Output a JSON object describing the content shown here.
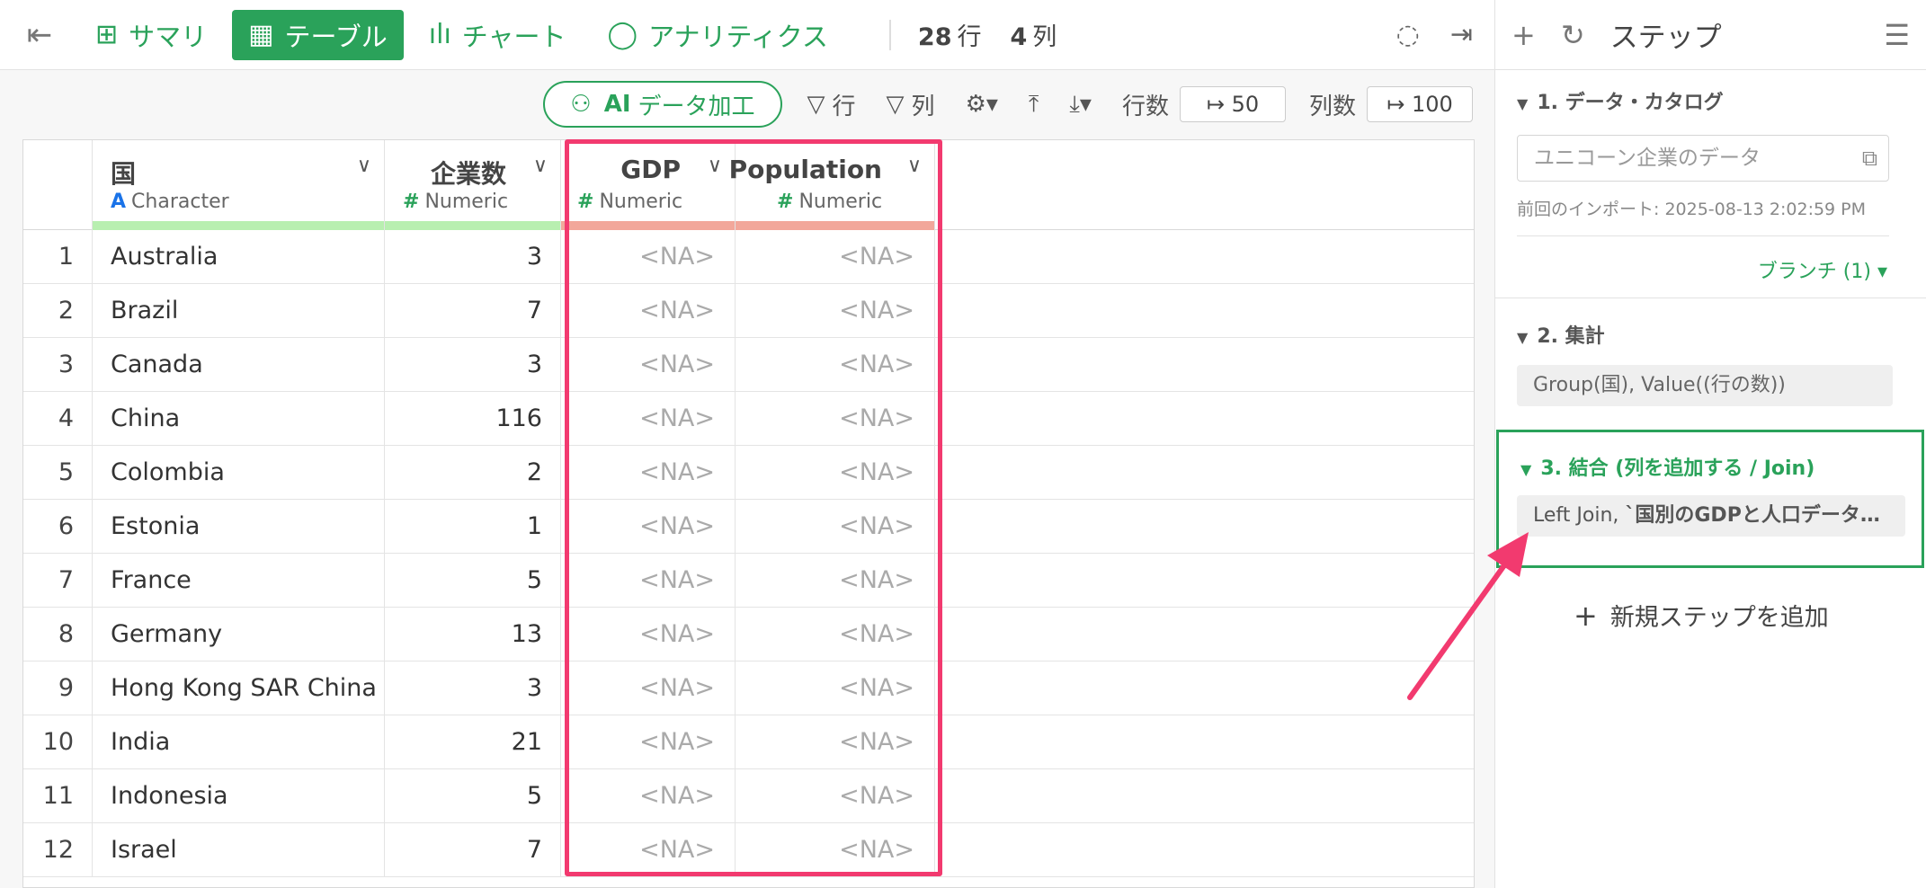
{
  "topbar": {
    "tabs": [
      {
        "label": "サマリ",
        "icon": "layout-icon",
        "glyph": "⊞"
      },
      {
        "label": "テーブル",
        "icon": "table-icon",
        "glyph": "▦"
      },
      {
        "label": "チャート",
        "icon": "bar-chart-icon",
        "glyph": "📊"
      },
      {
        "label": "アナリティクス",
        "icon": "lightbulb-icon",
        "glyph": "💡"
      }
    ],
    "active_tab": "テーブル",
    "rows_count": "28",
    "rows_unit": "行",
    "cols_count": "4",
    "cols_unit": "列"
  },
  "toolbar": {
    "ai_bold": "AI",
    "ai_label": "データ加工",
    "filter_rows": "行",
    "filter_cols": "列",
    "rows_label": "行数",
    "rows_value": "↦ 50",
    "cols_label": "列数",
    "cols_value": "↦ 100"
  },
  "table": {
    "columns": [
      {
        "name": "国",
        "type_symbol": "A",
        "type": "Character",
        "bar_color": "#b8efb0"
      },
      {
        "name": "企業数",
        "type_symbol": "#",
        "type": "Numeric",
        "bar_color": "#b8efb0"
      },
      {
        "name": "GDP",
        "type_symbol": "#",
        "type": "Numeric",
        "bar_color": "#f2a79a"
      },
      {
        "name": "Population",
        "type_symbol": "#",
        "type": "Numeric",
        "bar_color": "#f2a79a"
      }
    ],
    "rows": [
      {
        "idx": "1",
        "country": "Australia",
        "count": "3",
        "gdp": "<NA>",
        "pop": "<NA>"
      },
      {
        "idx": "2",
        "country": "Brazil",
        "count": "7",
        "gdp": "<NA>",
        "pop": "<NA>"
      },
      {
        "idx": "3",
        "country": "Canada",
        "count": "3",
        "gdp": "<NA>",
        "pop": "<NA>"
      },
      {
        "idx": "4",
        "country": "China",
        "count": "116",
        "gdp": "<NA>",
        "pop": "<NA>"
      },
      {
        "idx": "5",
        "country": "Colombia",
        "count": "2",
        "gdp": "<NA>",
        "pop": "<NA>"
      },
      {
        "idx": "6",
        "country": "Estonia",
        "count": "1",
        "gdp": "<NA>",
        "pop": "<NA>"
      },
      {
        "idx": "7",
        "country": "France",
        "count": "5",
        "gdp": "<NA>",
        "pop": "<NA>"
      },
      {
        "idx": "8",
        "country": "Germany",
        "count": "13",
        "gdp": "<NA>",
        "pop": "<NA>"
      },
      {
        "idx": "9",
        "country": "Hong Kong SAR China",
        "count": "3",
        "gdp": "<NA>",
        "pop": "<NA>"
      },
      {
        "idx": "10",
        "country": "India",
        "count": "21",
        "gdp": "<NA>",
        "pop": "<NA>"
      },
      {
        "idx": "11",
        "country": "Indonesia",
        "count": "5",
        "gdp": "<NA>",
        "pop": "<NA>"
      },
      {
        "idx": "12",
        "country": "Israel",
        "count": "7",
        "gdp": "<NA>",
        "pop": "<NA>"
      }
    ]
  },
  "panel": {
    "title": "ステップ",
    "steps": [
      {
        "title": "1. データ・カタログ",
        "input": "ユニコーン企業のデータ",
        "meta": "前回のインポート: 2025-08-13 2:02:59 PM",
        "branch": "ブランチ (1)"
      },
      {
        "title": "2. 集計",
        "chip": "Group(国), Value((行の数))"
      },
      {
        "title": "3. 結合 (列を追加する / Join)",
        "chip_pre": "Left Join, ",
        "chip_bold": "`国別のGDPと人口データ…"
      }
    ],
    "add_step": "新規ステップを追加"
  },
  "colors": {
    "accent": "#2aa25a",
    "highlight": "#f23a6f"
  }
}
